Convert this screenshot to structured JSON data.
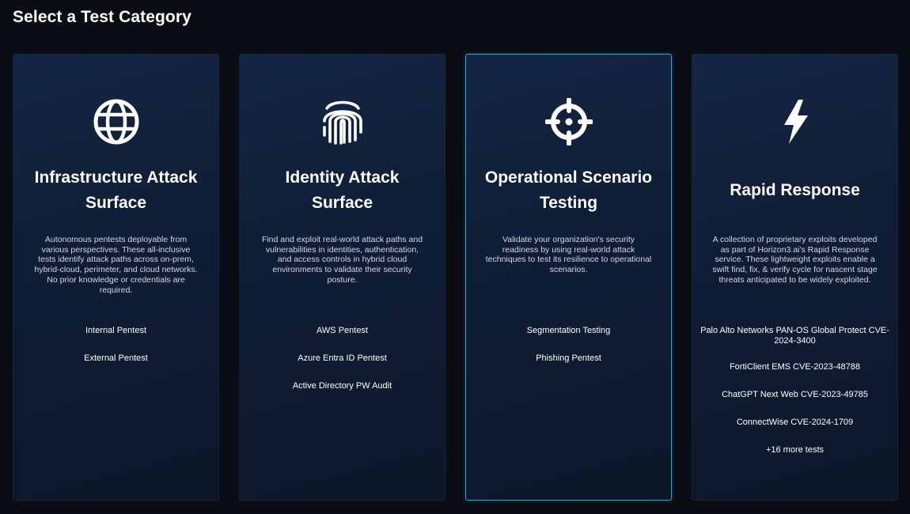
{
  "page": {
    "title": "Select a Test Category"
  },
  "colors": {
    "background": "#0a0d14",
    "card_top": "#142744",
    "card_bottom": "#0b1628",
    "selected_border": "#29a7dc",
    "text": "#ffffff",
    "description_text": "#d2d8e2"
  },
  "cards": [
    {
      "icon": "globe-icon",
      "title": "Infrastructure Attack Surface",
      "description": "Autonomous pentests deployable from various perspectives. These all-inclusive tests identify attack paths across on-prem, hybrid-cloud, perimeter, and cloud networks. No prior knowledge or credentials are required.",
      "tests": [
        "Internal Pentest",
        "External Pentest"
      ],
      "selected": false
    },
    {
      "icon": "fingerprint-icon",
      "title": "Identity Attack Surface",
      "description": "Find and exploit real-world attack paths and vulnerabilities in identities, authentication, and access controls in hybrid cloud environments to validate their security posture.",
      "tests": [
        "AWS Pentest",
        "Azure Entra ID Pentest",
        "Active Directory PW Audit"
      ],
      "selected": false
    },
    {
      "icon": "crosshair-icon",
      "title": "Operational Scenario Testing",
      "description": "Validate your organization's security readiness by using real-world attack techniques to test its resilience to operational scenarios.",
      "tests": [
        "Segmentation Testing",
        "Phishing Pentest"
      ],
      "selected": true
    },
    {
      "icon": "lightning-bolt-icon",
      "title": "Rapid Response",
      "description": "A collection of proprietary exploits developed as part of Horizon3.ai's Rapid Response service. These lightweight exploits enable a swift find, fix, & verify cycle for nascent stage threats anticipated to be widely exploited.",
      "tests": [
        "Palo Alto Networks PAN-OS Global Protect CVE-2024-3400",
        "FortiClient EMS CVE-2023-48788",
        "ChatGPT Next Web CVE-2023-49785",
        "ConnectWise CVE-2024-1709",
        "+16 more tests"
      ],
      "selected": false
    }
  ]
}
